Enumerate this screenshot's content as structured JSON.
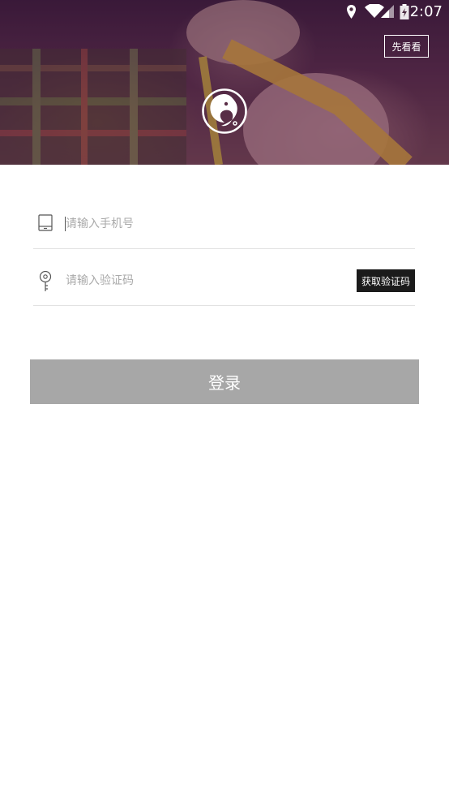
{
  "status_bar": {
    "time": "2:07"
  },
  "header": {
    "preview_label": "先看看"
  },
  "form": {
    "phone_placeholder": "请输入手机号",
    "code_placeholder": "请输入验证码",
    "get_code_label": "获取验证码",
    "login_label": "登录"
  },
  "icons": {
    "logo": "chameleon-logo-icon",
    "phone": "phone-icon",
    "code": "key-icon",
    "location": "location-icon",
    "wifi": "wifi-icon",
    "signal": "signal-icon",
    "battery": "battery-icon"
  },
  "colors": {
    "login_button": "#a7a7a7",
    "get_code_button": "#1b1b1b",
    "divider": "#e2e2e2"
  }
}
